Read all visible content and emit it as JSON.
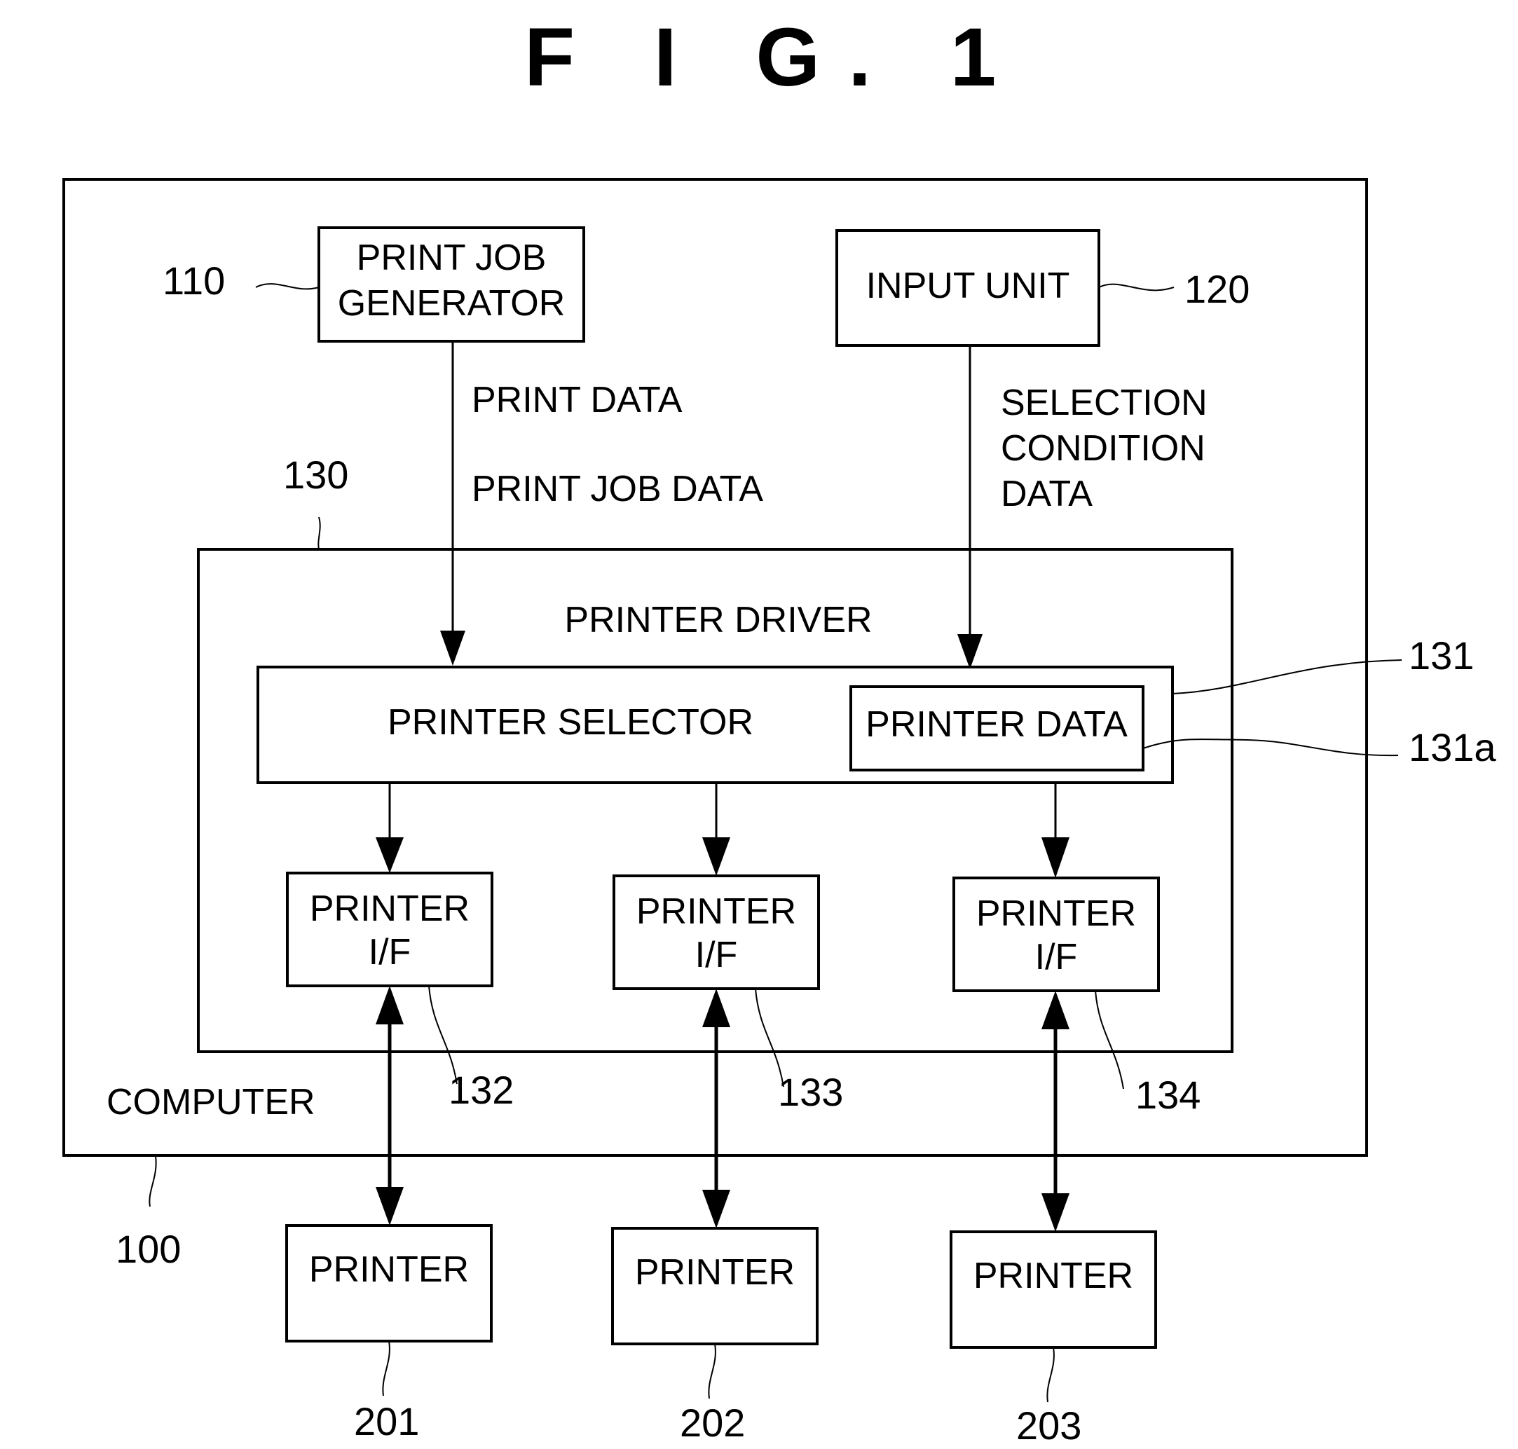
{
  "figure": {
    "title": "F I G.  1"
  },
  "computer": {
    "label": "COMPUTER",
    "ref": "100"
  },
  "print_job_generator": {
    "line1": "PRINT JOB",
    "line2": "GENERATOR",
    "ref": "110"
  },
  "input_unit": {
    "label": "INPUT UNIT",
    "ref": "120"
  },
  "flows": {
    "print_data": "PRINT DATA",
    "print_job_data": "PRINT JOB DATA",
    "selection_line1": "SELECTION",
    "selection_line2": "CONDITION",
    "selection_line3": "DATA"
  },
  "printer_driver": {
    "label": "PRINTER DRIVER",
    "ref": "130"
  },
  "printer_selector": {
    "label": "PRINTER SELECTOR",
    "ref": "131"
  },
  "printer_data": {
    "label": "PRINTER DATA",
    "ref": "131a"
  },
  "interfaces": [
    {
      "line1": "PRINTER",
      "line2": "I/F",
      "ref": "132"
    },
    {
      "line1": "PRINTER",
      "line2": "I/F",
      "ref": "133"
    },
    {
      "line1": "PRINTER",
      "line2": "I/F",
      "ref": "134"
    }
  ],
  "printers": [
    {
      "label": "PRINTER",
      "ref": "201"
    },
    {
      "label": "PRINTER",
      "ref": "202"
    },
    {
      "label": "PRINTER",
      "ref": "203"
    }
  ]
}
